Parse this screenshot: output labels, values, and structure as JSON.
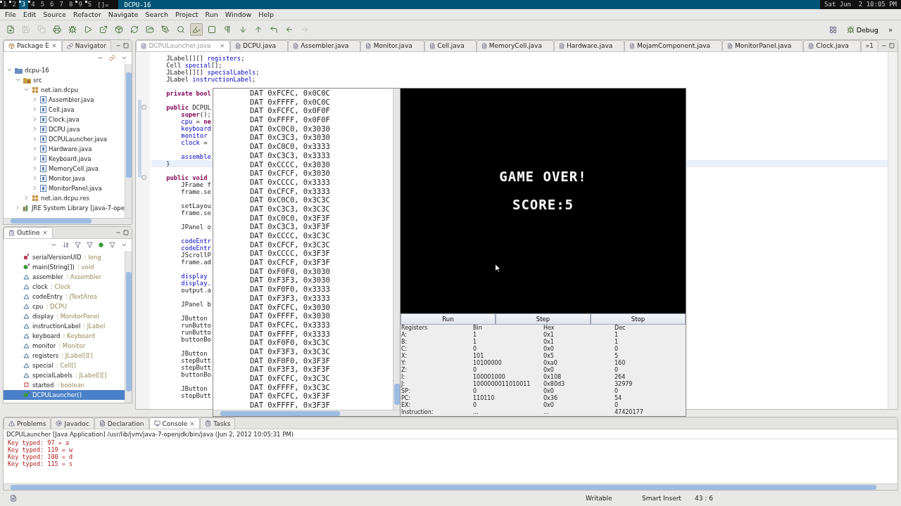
{
  "top_bar": {
    "workspaces": [
      {
        "label": "1",
        "occupied": true,
        "selected": false
      },
      {
        "label": "2",
        "occupied": true,
        "selected": false
      },
      {
        "label": "3",
        "occupied": true,
        "selected": true
      },
      {
        "label": "4",
        "occupied": true,
        "selected": false
      },
      {
        "label": "5",
        "occupied": false,
        "selected": false
      },
      {
        "label": "6",
        "occupied": false,
        "selected": false
      },
      {
        "label": "7",
        "occupied": false,
        "selected": false
      },
      {
        "label": "8",
        "occupied": false,
        "selected": false
      },
      {
        "label": "9",
        "occupied": true,
        "selected": false
      },
      {
        "label": "S",
        "occupied": true,
        "selected": false
      }
    ],
    "layout": "[]=",
    "title": "DCPU-16",
    "clock": "Sat Jun  2 10:05 PM"
  },
  "menu": [
    "File",
    "Edit",
    "Source",
    "Refactor",
    "Navigate",
    "Search",
    "Project",
    "Run",
    "Window",
    "Help"
  ],
  "toolbar": [
    {
      "kind": "new",
      "disabled": false,
      "pressed": false
    },
    {
      "kind": "save",
      "disabled": true,
      "pressed": false
    },
    {
      "kind": "copy",
      "disabled": true,
      "pressed": false
    },
    {
      "kind": "print",
      "disabled": false,
      "pressed": false
    },
    {
      "kind": "debug",
      "disabled": false,
      "pressed": false
    },
    {
      "kind": "run",
      "disabled": false,
      "pressed": false
    },
    {
      "kind": "external",
      "disabled": false,
      "pressed": false
    },
    {
      "kind": "package",
      "disabled": false,
      "pressed": false
    },
    {
      "kind": "refresh",
      "disabled": false,
      "pressed": false
    },
    {
      "kind": "open",
      "disabled": false,
      "pressed": false
    },
    {
      "kind": "pen",
      "disabled": false,
      "pressed": false
    },
    {
      "kind": "search",
      "disabled": false,
      "pressed": false
    },
    {
      "kind": "highlight",
      "disabled": false,
      "pressed": true
    },
    {
      "kind": "block",
      "disabled": false,
      "pressed": false
    },
    {
      "kind": "pilcrow",
      "disabled": false,
      "pressed": false
    },
    {
      "kind": "next",
      "disabled": false,
      "pressed": false
    },
    {
      "kind": "previous",
      "disabled": false,
      "pressed": false
    },
    {
      "kind": "last-edit",
      "disabled": false,
      "pressed": false
    },
    {
      "kind": "back",
      "disabled": false,
      "pressed": false
    },
    {
      "kind": "forward",
      "disabled": true,
      "pressed": false
    }
  ],
  "perspective": {
    "label": "Debug",
    "more": "»"
  },
  "package_explorer": {
    "tabs": [
      {
        "label": "Package E",
        "selected": true
      },
      {
        "label": "Navigator",
        "selected": false
      }
    ],
    "tree": [
      {
        "label": "dcpu-16",
        "kind": "project",
        "expanded": true,
        "children": [
          {
            "label": "src",
            "kind": "source-folder",
            "expanded": true,
            "children": [
              {
                "label": "net.ian.dcpu",
                "kind": "package",
                "expanded": true,
                "children": [
                  {
                    "label": "Assembler.java",
                    "kind": "java",
                    "expanded": false
                  },
                  {
                    "label": "Cell.java",
                    "kind": "java",
                    "expanded": false
                  },
                  {
                    "label": "Clock.java",
                    "kind": "java",
                    "expanded": false
                  },
                  {
                    "label": "DCPU.java",
                    "kind": "java",
                    "expanded": false
                  },
                  {
                    "label": "DCPULauncher.java",
                    "kind": "java",
                    "expanded": false
                  },
                  {
                    "label": "Hardware.java",
                    "kind": "java",
                    "expanded": false
                  },
                  {
                    "label": "Keyboard.java",
                    "kind": "java",
                    "expanded": false
                  },
                  {
                    "label": "MemoryCell.java",
                    "kind": "java",
                    "expanded": false
                  },
                  {
                    "label": "Monitor.java",
                    "kind": "java",
                    "expanded": false
                  },
                  {
                    "label": "MonitorPanel.java",
                    "kind": "java",
                    "expanded": false
                  }
                ]
              },
              {
                "label": "net.ian.dcpu.res",
                "kind": "package",
                "expanded": false
              }
            ]
          },
          {
            "label": "JRE System Library [java-7-ope",
            "kind": "library",
            "expanded": false
          }
        ]
      }
    ]
  },
  "outline": {
    "title": "Outline",
    "items": [
      {
        "kind": "constant",
        "name": "serialVersionUID",
        "type": ": long",
        "selected": false
      },
      {
        "kind": "static-method",
        "name": "main(String[])",
        "type": ": void",
        "selected": false
      },
      {
        "kind": "field",
        "name": "assembler",
        "type": ": Assembler",
        "selected": false
      },
      {
        "kind": "field",
        "name": "clock",
        "type": ": Clock",
        "selected": false
      },
      {
        "kind": "field",
        "name": "codeEntry",
        "type": ": JTextArea",
        "selected": false
      },
      {
        "kind": "field",
        "name": "cpu",
        "type": ": DCPU",
        "selected": false
      },
      {
        "kind": "field",
        "name": "display",
        "type": ": MonitorPanel",
        "selected": false
      },
      {
        "kind": "field",
        "name": "instructionLabel",
        "type": ": JLabel",
        "selected": false
      },
      {
        "kind": "field",
        "name": "keyboard",
        "type": ": Keyboard",
        "selected": false
      },
      {
        "kind": "field",
        "name": "monitor",
        "type": ": Monitor",
        "selected": false
      },
      {
        "kind": "field",
        "name": "registers",
        "type": ": JLabel[][]",
        "selected": false
      },
      {
        "kind": "field",
        "name": "special",
        "type": ": Cell[]",
        "selected": false
      },
      {
        "kind": "field",
        "name": "specialLabels",
        "type": ": JLabel[][]",
        "selected": false
      },
      {
        "kind": "private-field",
        "name": "started",
        "type": ": boolean",
        "selected": false
      },
      {
        "kind": "constructor",
        "name": "DCPULauncher()",
        "selected": true
      }
    ]
  },
  "editor": {
    "tabs": [
      {
        "label": "DCPULauncher.java",
        "selected": true
      },
      {
        "label": "DCPU.java",
        "selected": false
      },
      {
        "label": "Assembler.java",
        "selected": false
      },
      {
        "label": "Monitor.java",
        "selected": false
      },
      {
        "label": "Cell.java",
        "selected": false
      },
      {
        "label": "MemoryCell.java",
        "selected": false
      },
      {
        "label": "Hardware.java",
        "selected": false
      },
      {
        "label": "MojamComponent.java",
        "selected": false
      },
      {
        "label": "MonitorPanel.java",
        "selected": false
      },
      {
        "label": "Clock.java",
        "selected": false
      }
    ],
    "overflow": "»1",
    "lines": [
      {
        "kind": "code",
        "current": false,
        "parts": [
          {
            "text": "    JLabel[][] ",
            "kind": "plain"
          },
          {
            "text": "registers",
            "kind": "field"
          },
          {
            "text": ";",
            "kind": "plain"
          }
        ]
      },
      {
        "kind": "code",
        "current": false,
        "parts": [
          {
            "text": "    Cell ",
            "kind": "plain"
          },
          {
            "text": "special",
            "kind": "field"
          },
          {
            "text": "[];",
            "kind": "plain"
          }
        ]
      },
      {
        "kind": "code",
        "current": false,
        "parts": [
          {
            "text": "    JLabel[][] ",
            "kind": "plain"
          },
          {
            "text": "specialLabels",
            "kind": "field"
          },
          {
            "text": ";",
            "kind": "plain"
          }
        ]
      },
      {
        "kind": "code",
        "current": false,
        "parts": [
          {
            "text": "    JLabel ",
            "kind": "plain"
          },
          {
            "text": "instructionLabel",
            "kind": "field"
          },
          {
            "text": ";",
            "kind": "plain"
          }
        ]
      },
      {
        "kind": "blank",
        "current": false
      },
      {
        "kind": "code",
        "current": false,
        "parts": [
          {
            "text": "    private bool",
            "kind": "keyword"
          }
        ]
      },
      {
        "kind": "blank",
        "current": false
      },
      {
        "kind": "code",
        "current": false,
        "fold": true,
        "parts": [
          {
            "text": "    public",
            "kind": "keyword"
          },
          {
            "text": " DCPUL",
            "kind": "plain"
          }
        ]
      },
      {
        "kind": "code",
        "current": false,
        "parts": [
          {
            "text": "        super",
            "kind": "keyword"
          },
          {
            "text": "();",
            "kind": "plain"
          }
        ]
      },
      {
        "kind": "code",
        "current": false,
        "parts": [
          {
            "text": "        cpu",
            "kind": "field"
          },
          {
            "text": " = ",
            "kind": "plain"
          },
          {
            "text": "ne",
            "kind": "keyword"
          }
        ]
      },
      {
        "kind": "code",
        "current": false,
        "parts": [
          {
            "text": "        keyboard",
            "kind": "field"
          }
        ]
      },
      {
        "kind": "code",
        "current": false,
        "parts": [
          {
            "text": "        monitor",
            "kind": "field"
          }
        ]
      },
      {
        "kind": "code",
        "current": false,
        "parts": [
          {
            "text": "        clock",
            "kind": "field"
          },
          {
            "text": " =",
            "kind": "plain"
          }
        ]
      },
      {
        "kind": "blank",
        "current": false
      },
      {
        "kind": "code",
        "current": false,
        "parts": [
          {
            "text": "        assemble",
            "kind": "field"
          }
        ]
      },
      {
        "kind": "code",
        "current": true,
        "parts": [
          {
            "text": "    }",
            "kind": "plain"
          }
        ]
      },
      {
        "kind": "blank",
        "current": false
      },
      {
        "kind": "code",
        "current": false,
        "fold": true,
        "parts": [
          {
            "text": "    public void",
            "kind": "keyword"
          }
        ]
      },
      {
        "kind": "code",
        "current": false,
        "parts": [
          {
            "text": "        JFrame f",
            "kind": "plain"
          }
        ]
      },
      {
        "kind": "code",
        "current": false,
        "parts": [
          {
            "text": "        frame.se",
            "kind": "plain"
          }
        ]
      },
      {
        "kind": "blank",
        "current": false
      },
      {
        "kind": "code",
        "current": false,
        "parts": [
          {
            "text": "        setLayou",
            "kind": "plain"
          }
        ]
      },
      {
        "kind": "code",
        "current": false,
        "parts": [
          {
            "text": "        frame.se",
            "kind": "plain"
          }
        ]
      },
      {
        "kind": "blank",
        "current": false
      },
      {
        "kind": "code",
        "current": false,
        "parts": [
          {
            "text": "        JPanel o",
            "kind": "plain"
          }
        ]
      },
      {
        "kind": "blank",
        "current": false
      },
      {
        "kind": "code",
        "current": false,
        "parts": [
          {
            "text": "        codeEntr",
            "kind": "field"
          }
        ]
      },
      {
        "kind": "code",
        "current": false,
        "parts": [
          {
            "text": "        codeEntr",
            "kind": "field"
          }
        ]
      },
      {
        "kind": "code",
        "current": false,
        "parts": [
          {
            "text": "        JScrollP",
            "kind": "plain"
          }
        ]
      },
      {
        "kind": "code",
        "current": false,
        "parts": [
          {
            "text": "        frame.ad",
            "kind": "plain"
          }
        ]
      },
      {
        "kind": "blank",
        "current": false
      },
      {
        "kind": "code",
        "current": false,
        "parts": [
          {
            "text": "        display",
            "kind": "field"
          }
        ]
      },
      {
        "kind": "code",
        "current": false,
        "parts": [
          {
            "text": "        display.",
            "kind": "field"
          }
        ]
      },
      {
        "kind": "code",
        "current": false,
        "parts": [
          {
            "text": "        output.a",
            "kind": "plain"
          }
        ]
      },
      {
        "kind": "blank",
        "current": false
      },
      {
        "kind": "code",
        "current": false,
        "parts": [
          {
            "text": "        JPanel b",
            "kind": "plain"
          }
        ]
      },
      {
        "kind": "blank",
        "current": false
      },
      {
        "kind": "code",
        "current": false,
        "parts": [
          {
            "text": "        JButton",
            "kind": "plain"
          }
        ]
      },
      {
        "kind": "code",
        "current": false,
        "parts": [
          {
            "text": "        runButto",
            "kind": "plain"
          }
        ]
      },
      {
        "kind": "code",
        "current": false,
        "parts": [
          {
            "text": "        runButto",
            "kind": "plain"
          }
        ]
      },
      {
        "kind": "code",
        "current": false,
        "parts": [
          {
            "text": "        buttonBo",
            "kind": "plain"
          }
        ]
      },
      {
        "kind": "blank",
        "current": false
      },
      {
        "kind": "code",
        "current": false,
        "parts": [
          {
            "text": "        JButton",
            "kind": "plain"
          }
        ]
      },
      {
        "kind": "code",
        "current": false,
        "parts": [
          {
            "text": "        stepButt",
            "kind": "plain"
          }
        ]
      },
      {
        "kind": "code",
        "current": false,
        "parts": [
          {
            "text": "        stepButt",
            "kind": "plain"
          }
        ]
      },
      {
        "kind": "code",
        "current": false,
        "parts": [
          {
            "text": "        buttonBo",
            "kind": "plain"
          }
        ]
      },
      {
        "kind": "blank",
        "current": false
      },
      {
        "kind": "code",
        "current": false,
        "parts": [
          {
            "text": "        JButton",
            "kind": "plain"
          }
        ]
      },
      {
        "kind": "code",
        "current": false,
        "parts": [
          {
            "text": "        stopButt",
            "kind": "plain"
          }
        ]
      }
    ]
  },
  "dcpu_window": {
    "code": [
      "DAT 0xFCFC, 0x0C0C",
      "DAT 0xFFFF, 0x0C0C",
      "DAT 0xFCFC, 0x0F0F",
      "DAT 0xFFFF, 0x0F0F",
      "DAT 0xC0C0, 0x3030",
      "DAT 0xC3C3, 0x3030",
      "DAT 0xC0C0, 0x3333",
      "DAT 0xC3C3, 0x3333",
      "DAT 0xCCCC, 0x3030",
      "DAT 0xCFCF, 0x3030",
      "DAT 0xCCCC, 0x3333",
      "DAT 0xCFCF, 0x3333",
      "DAT 0xC0C0, 0x3C3C",
      "DAT 0xC3C3, 0x3C3C",
      "DAT 0xC0C0, 0x3F3F",
      "DAT 0xC3C3, 0x3F3F",
      "DAT 0xCCCC, 0x3C3C",
      "DAT 0xCFCF, 0x3C3C",
      "DAT 0xCCCC, 0x3F3F",
      "DAT 0xCFCF, 0x3F3F",
      "DAT 0xF0F0, 0x3030",
      "DAT 0xF3F3, 0x3030",
      "DAT 0xF0F0, 0x3333",
      "DAT 0xF3F3, 0x3333",
      "DAT 0xFCFC, 0x3030",
      "DAT 0xFFFF, 0x3030",
      "DAT 0xFCFC, 0x3333",
      "DAT 0xFFFF, 0x3333",
      "DAT 0xF0F0, 0x3C3C",
      "DAT 0xF3F3, 0x3C3C",
      "DAT 0xF0F0, 0x3F3F",
      "DAT 0xF3F3, 0x3F3F",
      "DAT 0xFCFC, 0x3C3C",
      "DAT 0xFFFF, 0x3C3C",
      "DAT 0xFCFC, 0x3F3F",
      "DAT 0xFFFF, 0x3F3F"
    ],
    "screen": [
      "GAME OVER!",
      "SCORE:5"
    ],
    "buttons": [
      "Run",
      "Step",
      "Stop"
    ],
    "registers": {
      "columns": [
        "Registers",
        "Bin",
        "Hex",
        "Dec"
      ],
      "rows": [
        [
          "A:",
          "1",
          "0x1",
          "1"
        ],
        [
          "B:",
          "1",
          "0x1",
          "1"
        ],
        [
          "C:",
          "0",
          "0x0",
          "0"
        ],
        [
          "X:",
          "101",
          "0x5",
          "5"
        ],
        [
          "Y:",
          "10100000",
          "0xa0",
          "160"
        ],
        [
          "Z:",
          "0",
          "0x0",
          "0"
        ],
        [
          "I:",
          "100001000",
          "0x108",
          "264"
        ],
        [
          "J:",
          "1000000011010011",
          "0x80d3",
          "32979"
        ],
        [
          "SP:",
          "0",
          "0x0",
          "0"
        ],
        [
          "PC:",
          "110110",
          "0x36",
          "54"
        ],
        [
          "EX:",
          "0",
          "0x0",
          "0"
        ],
        [
          "Instruction:",
          "...",
          "...",
          "47420177"
        ]
      ]
    }
  },
  "bottom": {
    "tabs": [
      {
        "label": "Problems",
        "selected": false
      },
      {
        "label": "Javadoc",
        "selected": false
      },
      {
        "label": "Declaration",
        "selected": false
      },
      {
        "label": "Console",
        "selected": true
      },
      {
        "label": "Tasks",
        "selected": false
      }
    ],
    "console_title": "DCPULauncher [Java Application] /usr/lib/jvm/java-7-openjdk/bin/java (Jun 2, 2012 10:05:31 PM)",
    "console_lines": [
      "Key typed: 97 = a",
      "Key typed: 119 = w",
      "Key typed: 100 = d",
      "Key typed: 115 = s"
    ]
  },
  "status_bar": [
    "Writable",
    "Smart Insert",
    "43 : 6"
  ]
}
